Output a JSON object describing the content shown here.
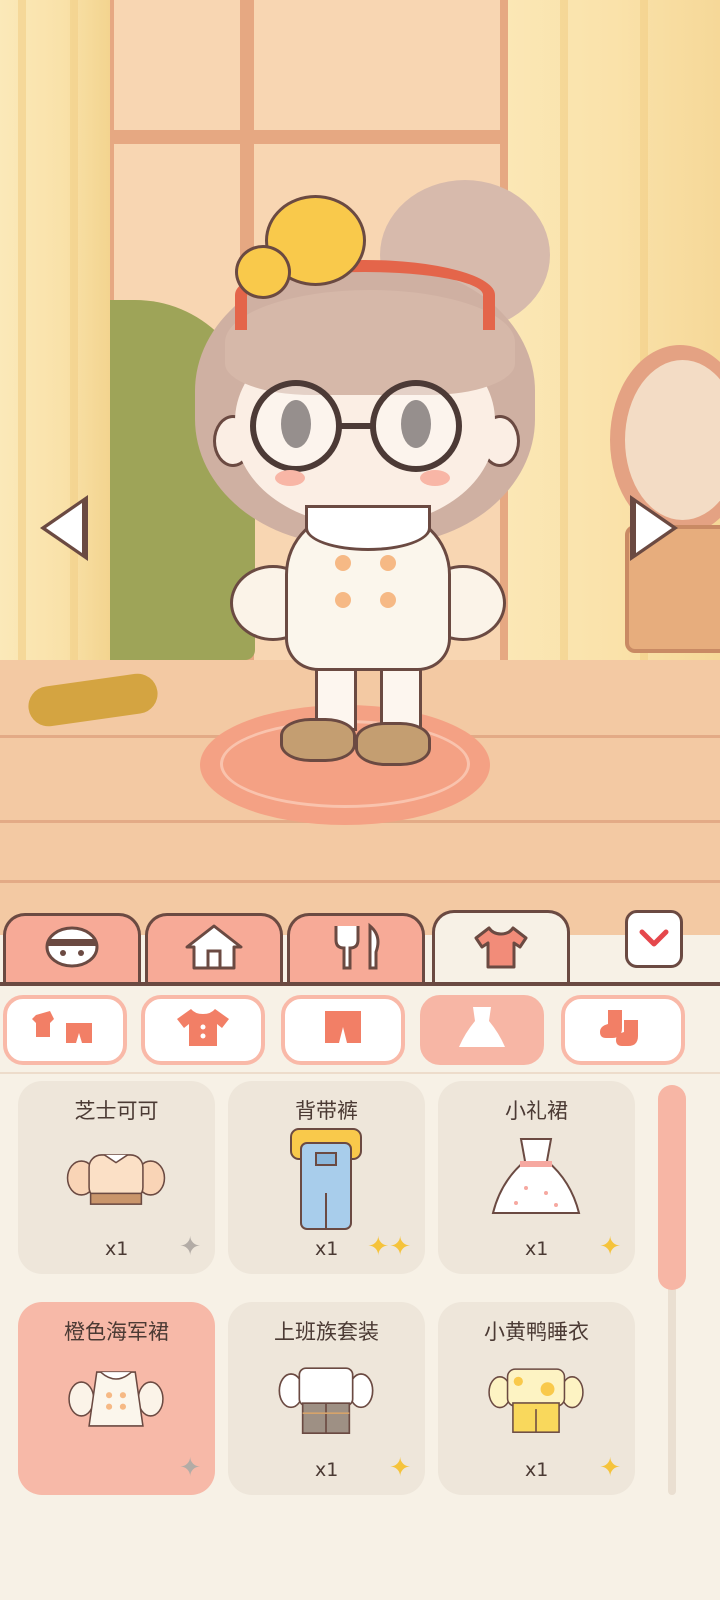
{
  "navigation": {
    "prev_icon": "triangle-left",
    "next_icon": "triangle-right"
  },
  "tabs": [
    {
      "icon": "face-icon",
      "active": false
    },
    {
      "icon": "house-icon",
      "active": false
    },
    {
      "icon": "utensils-icon",
      "active": false
    },
    {
      "icon": "shirt-icon",
      "active": true
    }
  ],
  "collapse_icon": "chevron-down-icon",
  "subcategories": [
    {
      "icon": "outfit-set-icon",
      "active": false
    },
    {
      "icon": "top-icon",
      "active": false
    },
    {
      "icon": "pants-icon",
      "active": false
    },
    {
      "icon": "dress-icon",
      "active": true
    },
    {
      "icon": "socks-icon",
      "active": false
    }
  ],
  "items": [
    {
      "name": "芝士可可",
      "qty": "x1",
      "rarity": "gray-sparkle",
      "selected": false
    },
    {
      "name": "背带裤",
      "qty": "x1",
      "rarity": "double-gold-sparkle",
      "selected": false
    },
    {
      "name": "小礼裙",
      "qty": "x1",
      "rarity": "gold-sparkle",
      "selected": false
    },
    {
      "name": "橙色海军裙",
      "qty": "",
      "rarity": "gray-sparkle",
      "selected": true
    },
    {
      "name": "上班族套装",
      "qty": "x1",
      "rarity": "gold-sparkle",
      "selected": false
    },
    {
      "name": "小黄鸭睡衣",
      "qty": "x1",
      "rarity": "gold-sparkle",
      "selected": false
    }
  ],
  "colors": {
    "accent": "#f7aa97",
    "outline": "#6b4a42",
    "selected_card": "#f7b9a8",
    "card_bg": "#eee6da",
    "gold": "#f5c33b"
  }
}
